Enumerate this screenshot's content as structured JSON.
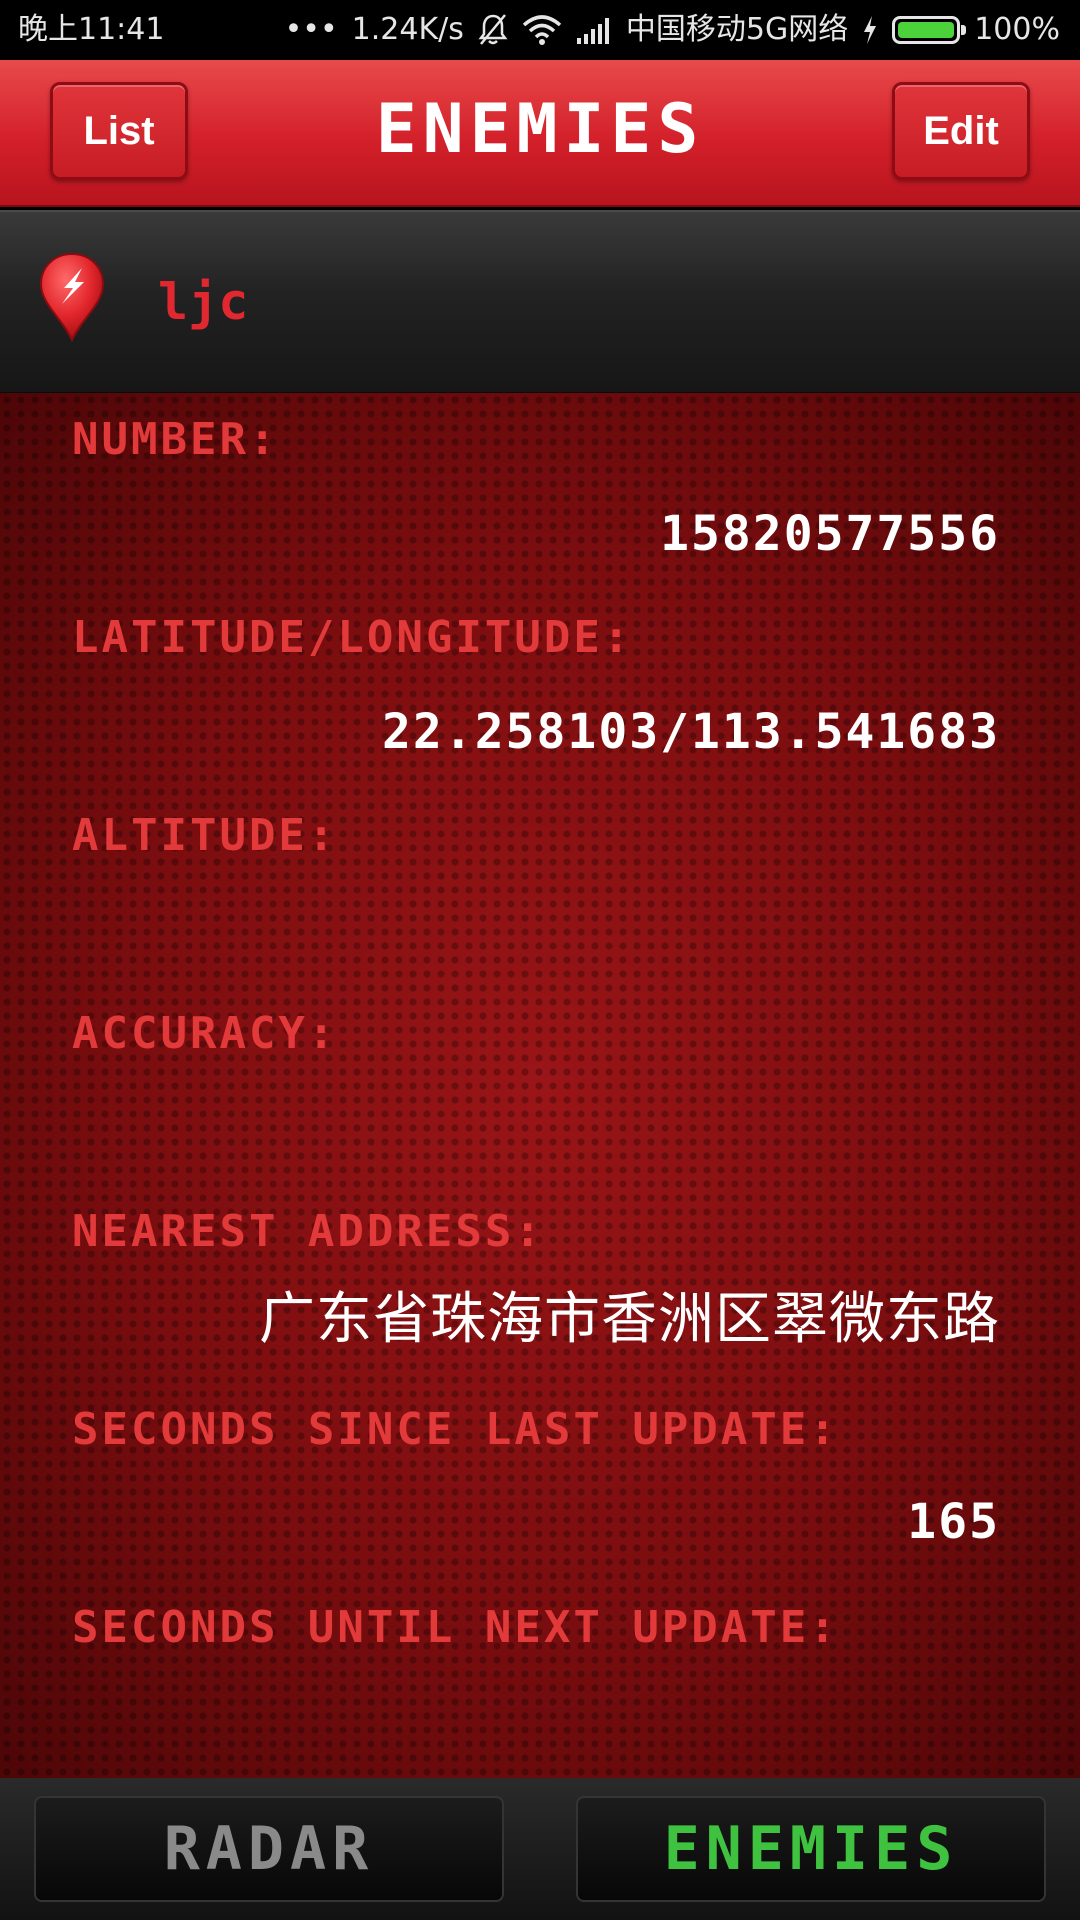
{
  "status_bar": {
    "time": "晚上11:41",
    "dots": "•••",
    "network_speed": "1.24K/s",
    "carrier": "中国移动5G网络",
    "battery_percent": "100%",
    "battery_level": 1.0,
    "icons": [
      "silent-bell-icon",
      "wifi-icon",
      "signal-icon",
      "charging-icon",
      "battery-icon"
    ]
  },
  "header": {
    "left_button": "List",
    "title": "ENEMIES",
    "right_button": "Edit"
  },
  "contact": {
    "name": "ljc",
    "icon": "location-pin-icon"
  },
  "fields": {
    "number_label": "NUMBER:",
    "number_value": "15820577556",
    "latlng_label": "LATITUDE/LONGITUDE:",
    "latlng_value": "22.258103/113.541683",
    "altitude_label": "ALTITUDE:",
    "accuracy_label": "ACCURACY:",
    "address_label": "NEAREST ADDRESS:",
    "address_value": "广东省珠海市香洲区翠微东路",
    "since_label": "SECONDS SINCE LAST UPDATE:",
    "since_value": "165",
    "until_label": "SECONDS UNTIL NEXT UPDATE:"
  },
  "bottom_nav": {
    "radar": "RADAR",
    "enemies": "ENEMIES",
    "active": "enemies"
  },
  "colors": {
    "header_red": "#d3202a",
    "label_red": "#e23a3b",
    "active_tab_green": "#3fc23f",
    "inactive_tab_gray": "#8a8a8a"
  }
}
